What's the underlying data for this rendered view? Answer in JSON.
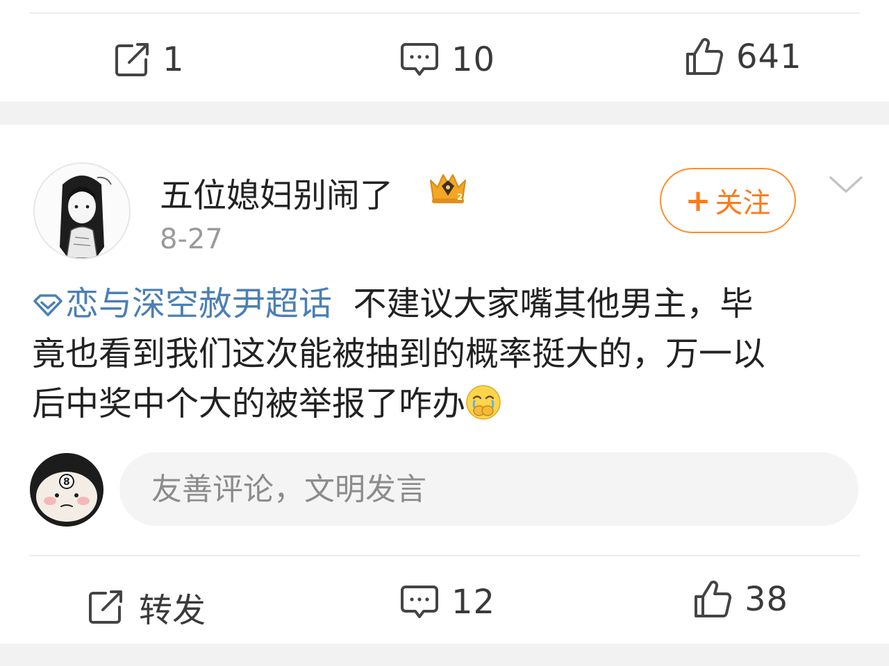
{
  "prev_post": {
    "repost_count": "1",
    "comment_count": "10",
    "like_count": "641"
  },
  "post": {
    "username": "五位媳妇别闹了",
    "date": "8-27",
    "follow_label": "关注",
    "follow_plus": "+",
    "topic": "恋与深空赦尹超话",
    "text_line1": "不建议大家嘴其他男主，毕",
    "text_line2": "竟也看到我们这次能被抽到的概率挺大的，万一以",
    "text_line3": "后中奖中个大的被举报了咋办",
    "comment_placeholder": "友善评论，文明发言",
    "repost_label": "转发",
    "comment_count": "12",
    "like_count": "38"
  },
  "colors": {
    "accent_orange": "#ff7a1c",
    "topic_blue": "#4a7fb5",
    "page_bg": "#f2f2f2"
  },
  "icons": [
    "repost-icon",
    "comment-icon",
    "like-icon",
    "crown-badge-icon",
    "chevron-down-icon",
    "diamond-topic-icon",
    "covering-mouth-emoji"
  ]
}
